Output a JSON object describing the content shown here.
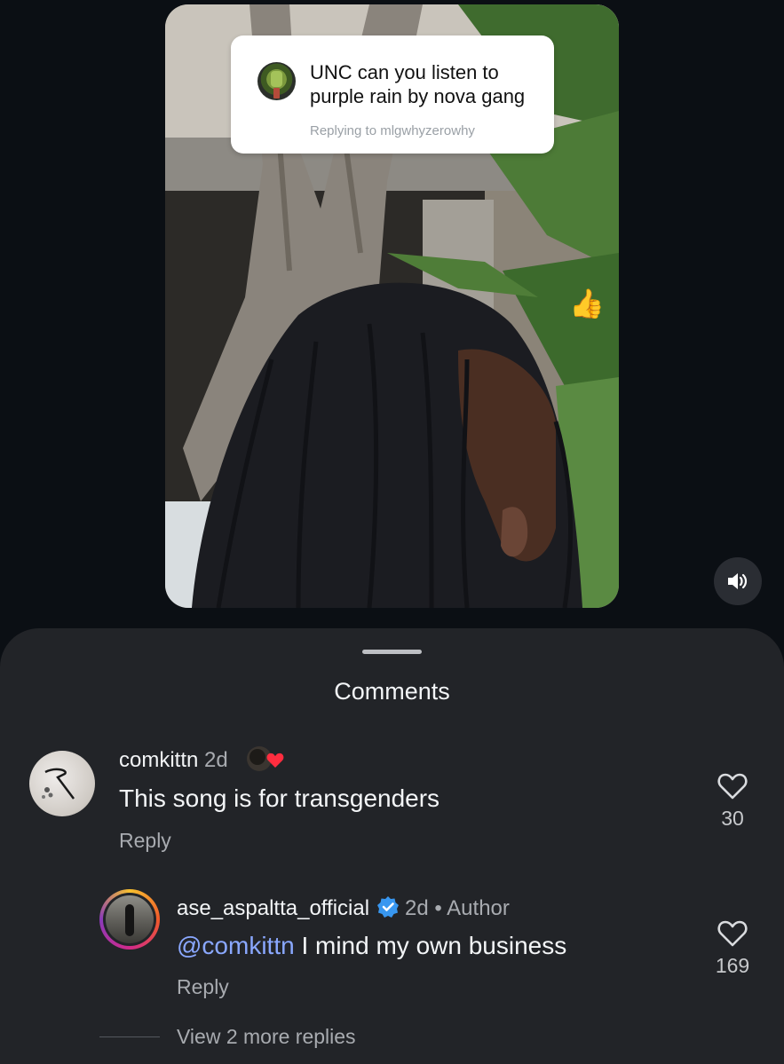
{
  "video": {
    "sticker": {
      "text": "UNC can you listen to purple rain by nova gang",
      "replying_to": "Replying to mlgwhyzerowhy"
    },
    "thumb_emoji": "👍",
    "sound_icon": "speaker-icon"
  },
  "comments_sheet": {
    "title": "Comments",
    "comments": [
      {
        "username": "comkittn",
        "age": "2d",
        "text": "This song is for transgenders",
        "reply_label": "Reply",
        "likes": "30",
        "reaction_icon": "heart-reaction-icon"
      }
    ],
    "reply": {
      "username": "ase_aspaltta_official",
      "age": "2d",
      "separator": "•",
      "author_label": "Author",
      "mention": "@comkittn",
      "text": " I mind my own business",
      "reply_label": "Reply",
      "likes": "169",
      "verified_icon": "verified-badge-icon"
    },
    "view_more": "View 2 more replies"
  },
  "colors": {
    "background": "#0b0f14",
    "sheet": "#222428",
    "mention": "#8aa8ff",
    "verified": "#3897f0",
    "heart": "#ff2d3f"
  }
}
